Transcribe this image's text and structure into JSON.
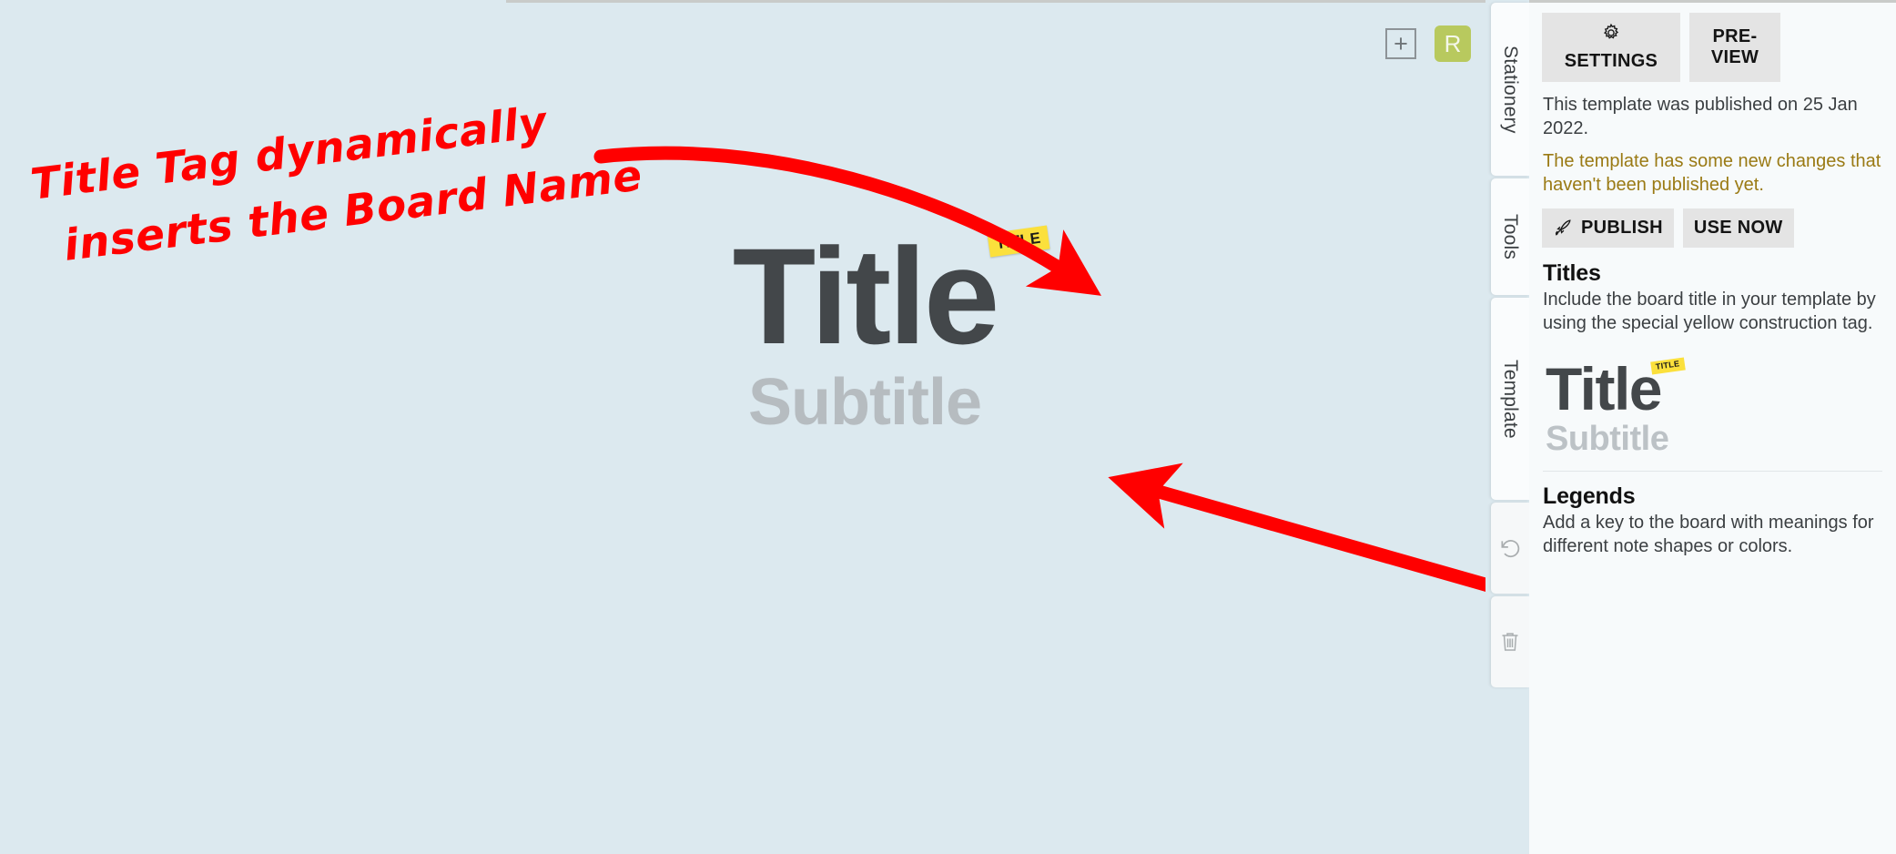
{
  "canvas": {
    "board": {
      "title": "Title",
      "title_tag": "TITLE",
      "subtitle": "Subtitle"
    },
    "controls": {
      "add_label": "+",
      "add_icon": "plus-icon",
      "avatar_initial": "R",
      "avatar_color": "#b8c95e"
    },
    "annotation": {
      "line1": "Title Tag dynamically",
      "line2": "inserts the Board Name",
      "color": "#ff0000"
    }
  },
  "tab_rail": {
    "tabs": [
      {
        "label": "Stationery",
        "icon": "stationery-tab"
      },
      {
        "label": "Tools",
        "icon": "tools-tab"
      },
      {
        "label": "Template",
        "icon": "template-tab"
      }
    ],
    "icon_buttons": [
      {
        "name": "undo-icon",
        "label": "Undo"
      },
      {
        "name": "trash-icon",
        "label": "Delete"
      }
    ]
  },
  "panel": {
    "actions": {
      "settings_label": "SETTINGS",
      "settings_icon": "gear-icon",
      "preview_label": "PRE-\nVIEW"
    },
    "published_note": "This template was published on 25 Jan 2022.",
    "unpublished_warning": "The template has some new changes that haven't been published yet.",
    "warning_color": "#9a7a14",
    "publish_label": "PUBLISH",
    "publish_icon": "rocket-icon",
    "use_now_label": "USE NOW",
    "sections": [
      {
        "title": "Titles",
        "description": "Include the board title in your template by using the special yellow construction tag.",
        "preview": {
          "title": "Title",
          "title_tag": "TITLE",
          "subtitle": "Subtitle"
        }
      },
      {
        "title": "Legends",
        "description": "Add a key to the board with meanings for different note shapes or colors."
      }
    ]
  }
}
